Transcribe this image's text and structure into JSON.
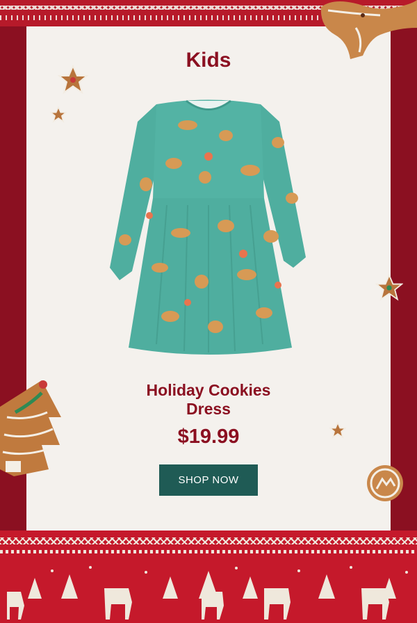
{
  "section": {
    "label": "Kids"
  },
  "product": {
    "title_line1": "Holiday Cookies",
    "title_line2": "Dress",
    "price": "$19.99",
    "image_alt": "Green long-sleeve dress with gingerbread cookie print"
  },
  "cta": {
    "label": "SHOP NOW"
  },
  "colors": {
    "brand_red": "#8b1021",
    "button_green": "#1f5b55",
    "card": "#f4f1ed",
    "dress": "#4fae9f"
  },
  "icons": [
    "star-cookie-icon",
    "tree-cookie-icon",
    "reindeer-cookie-icon",
    "round-cookie-icon"
  ]
}
